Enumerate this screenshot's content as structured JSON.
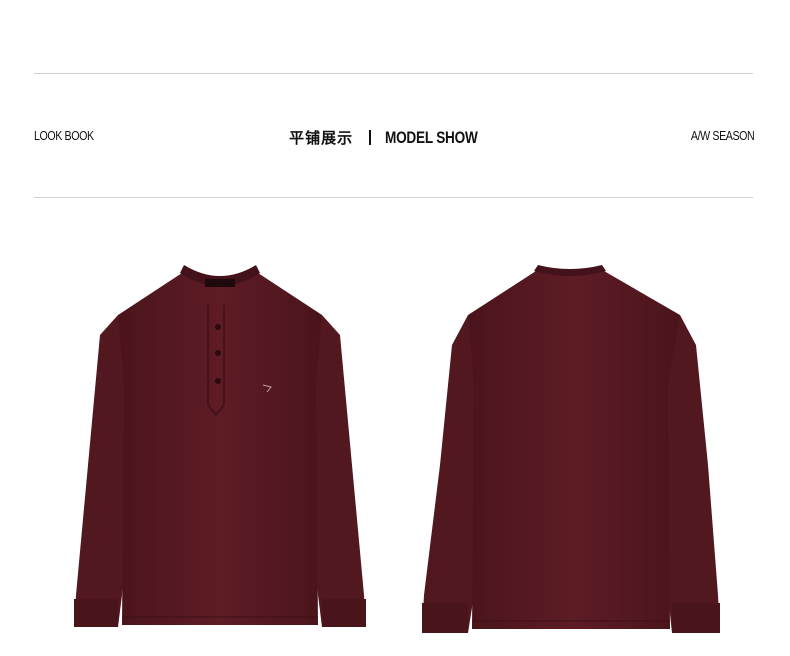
{
  "header": {
    "left_label": "LOOK BOOK",
    "center_cn": "平铺展示",
    "center_en": "MODEL SHOW",
    "right_label": "A/W SEASON"
  },
  "products": [
    {
      "view": "front",
      "color": "#5a1a22"
    },
    {
      "view": "back",
      "color": "#5a1a22"
    }
  ]
}
